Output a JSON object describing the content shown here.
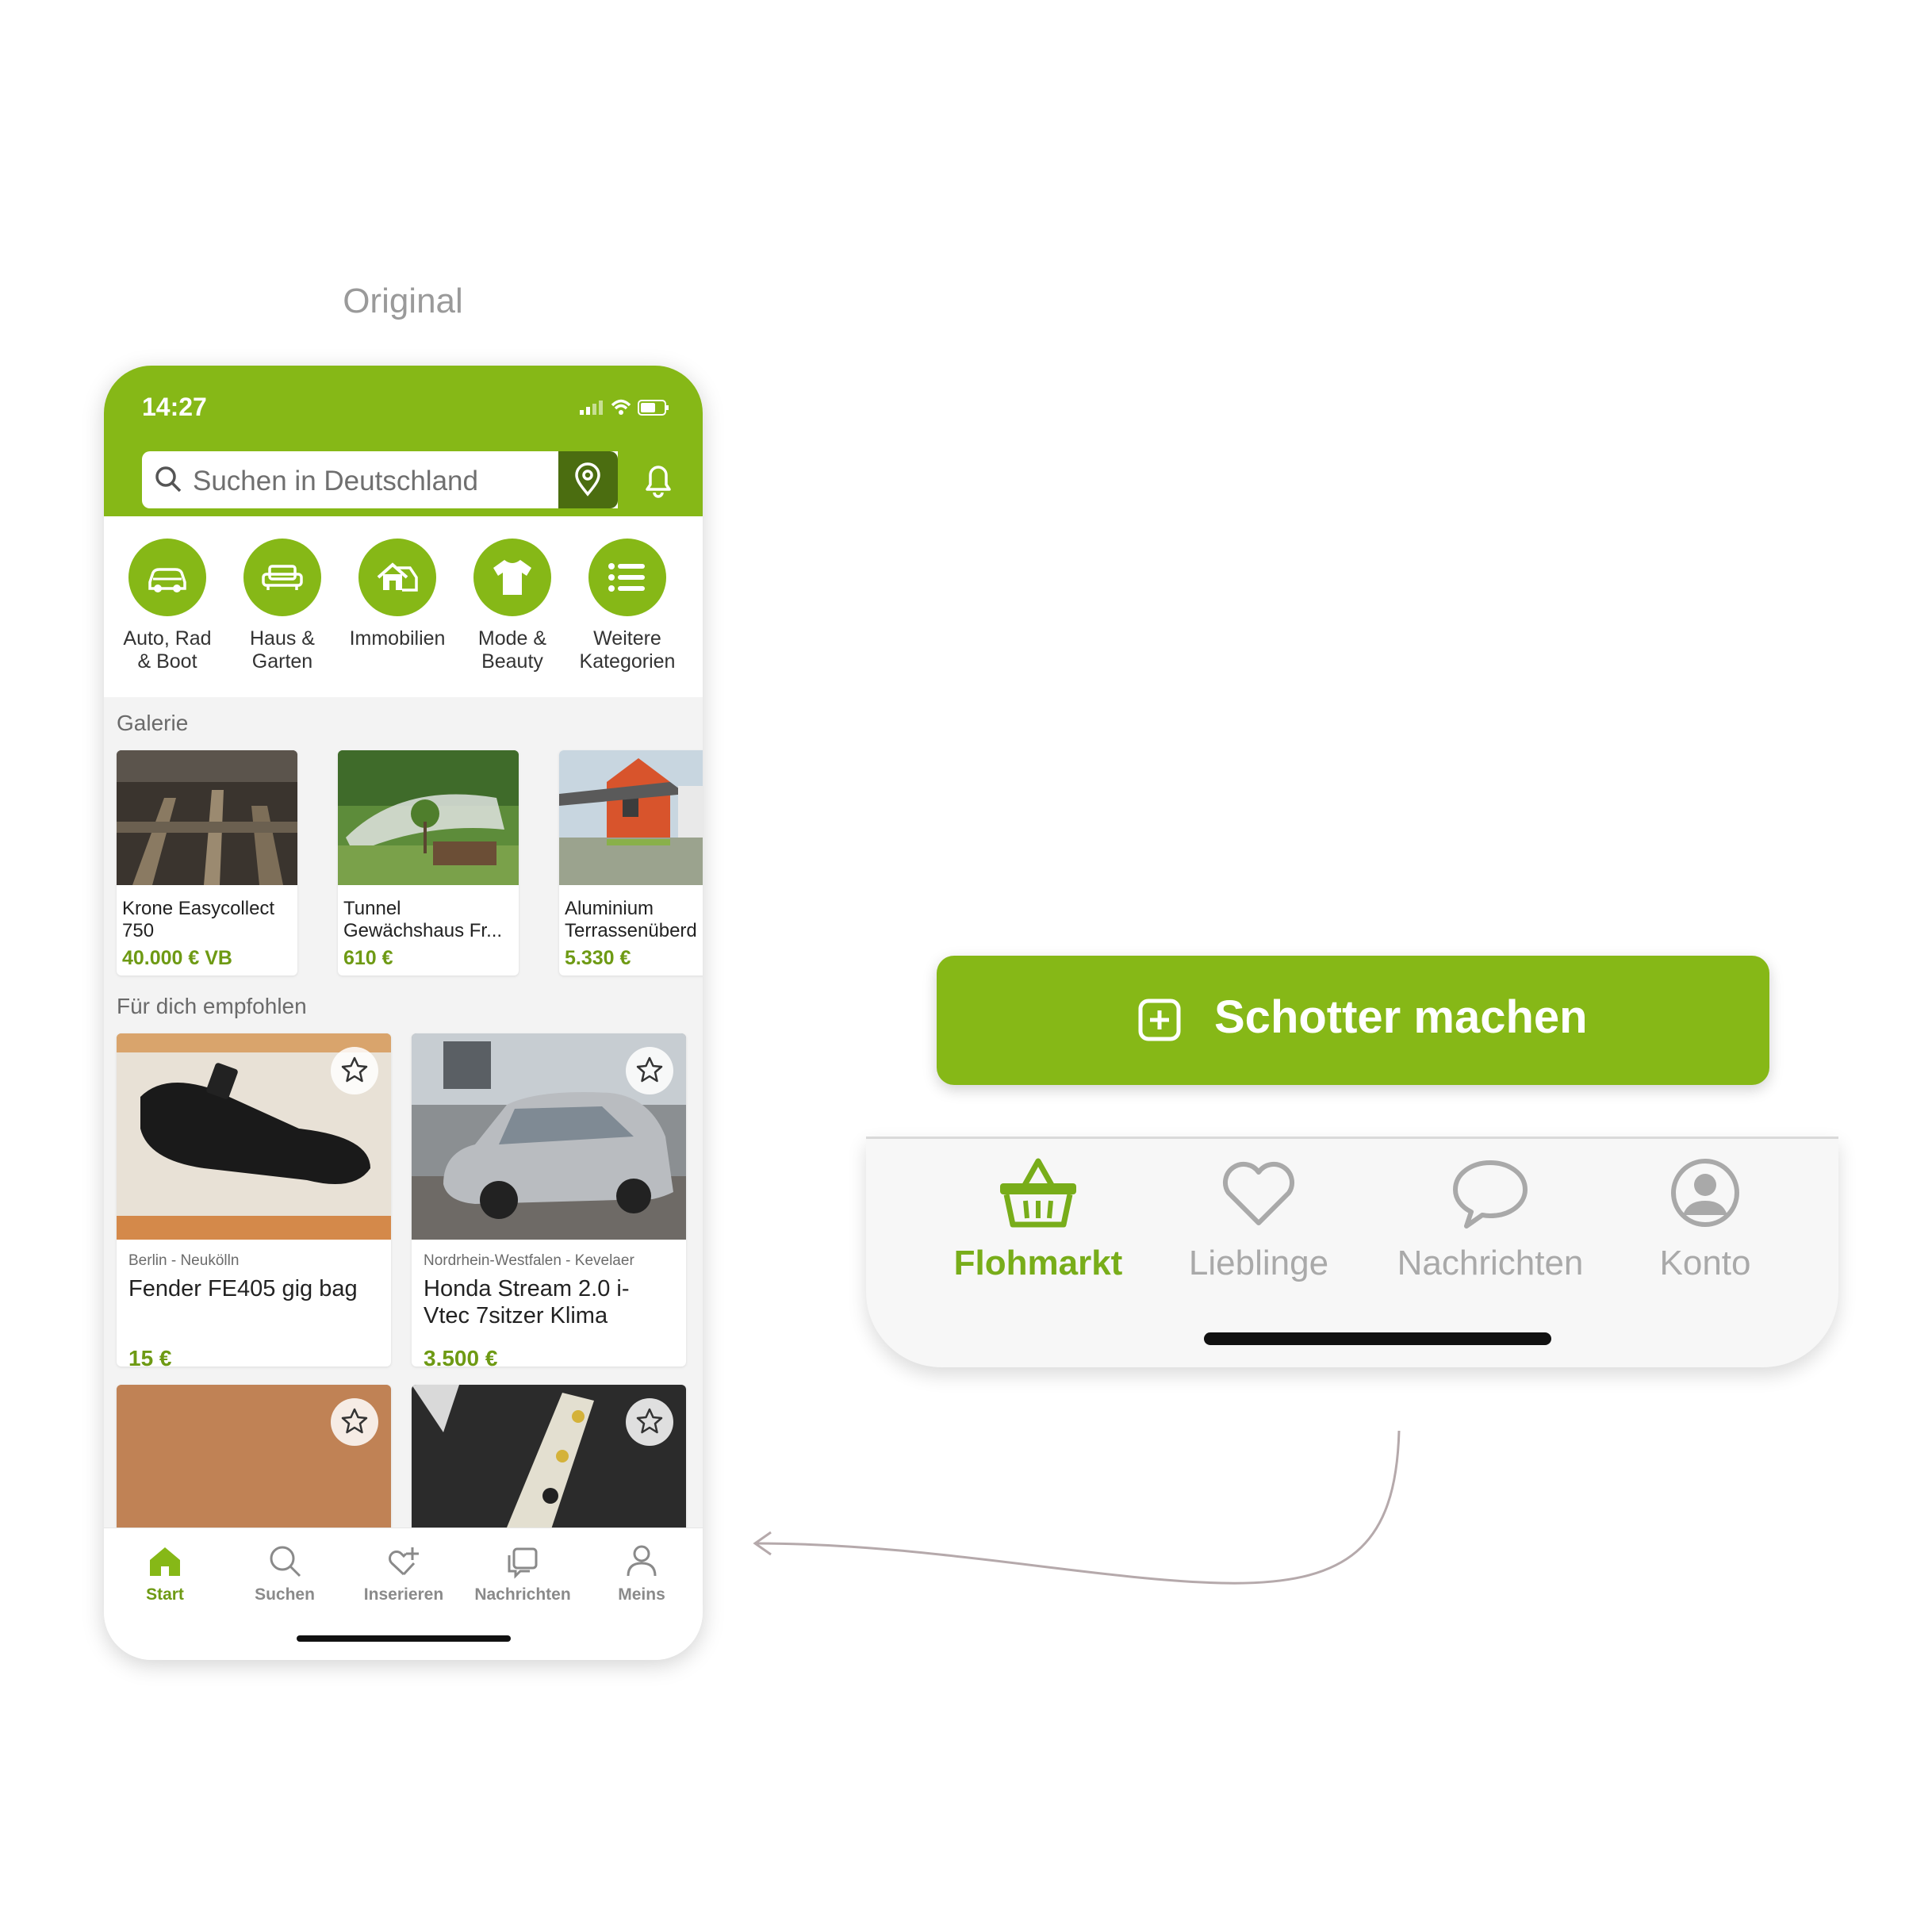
{
  "caption": "Original",
  "status": {
    "time": "14:27"
  },
  "search": {
    "placeholder": "Suchen in Deutschland"
  },
  "icons": {
    "search": "search-icon",
    "location": "location-pin-icon",
    "bell": "bell-icon"
  },
  "categories": [
    {
      "label": "Auto, Rad\n& Boot",
      "icon": "car-icon"
    },
    {
      "label": "Haus &\nGarten",
      "icon": "sofa-icon"
    },
    {
      "label": "Immobilien",
      "icon": "house-icon"
    },
    {
      "label": "Mode &\nBeauty",
      "icon": "shirt-icon"
    },
    {
      "label": "Weitere\nKategorien",
      "icon": "list-icon"
    }
  ],
  "gallery": {
    "title": "Galerie",
    "items": [
      {
        "title": "Krone Easycollect\n750",
        "price": "40.000 € VB"
      },
      {
        "title": "Tunnel\nGewächshaus Fr...",
        "price": "610 €"
      },
      {
        "title": "Aluminium\nTerrassenüberd",
        "price": "5.330 €"
      }
    ]
  },
  "recommended": {
    "title": "Für dich empfohlen",
    "items": [
      {
        "location": "Berlin - Neukölln",
        "title": "Fender FE405 gig bag",
        "price": "15 €"
      },
      {
        "location": "Nordrhein-Westfalen - Kevelaer",
        "title": "Honda Stream 2.0 i-\nVtec 7sitzer Klima",
        "price": "3.500 €"
      }
    ]
  },
  "tabbar": [
    {
      "label": "Start",
      "icon": "home-icon",
      "active": true
    },
    {
      "label": "Suchen",
      "icon": "search-icon",
      "active": false
    },
    {
      "label": "Inserieren",
      "icon": "tag-plus-icon",
      "active": false
    },
    {
      "label": "Nachrichten",
      "icon": "chat-icon",
      "active": false
    },
    {
      "label": "Meins",
      "icon": "person-icon",
      "active": false
    }
  ],
  "cta": {
    "label": "Schotter machen",
    "icon": "plus-square-icon"
  },
  "redesign_tabbar": [
    {
      "label": "Flohmarkt",
      "icon": "basket-icon",
      "active": true
    },
    {
      "label": "Lieblinge",
      "icon": "heart-icon",
      "active": false
    },
    {
      "label": "Nachrichten",
      "icon": "speech-bubble-icon",
      "active": false
    },
    {
      "label": "Konto",
      "icon": "account-icon",
      "active": false
    }
  ],
  "colors": {
    "brand_green": "#86b817",
    "dark_green": "#4b6d10",
    "price_green": "#6e9a14"
  }
}
